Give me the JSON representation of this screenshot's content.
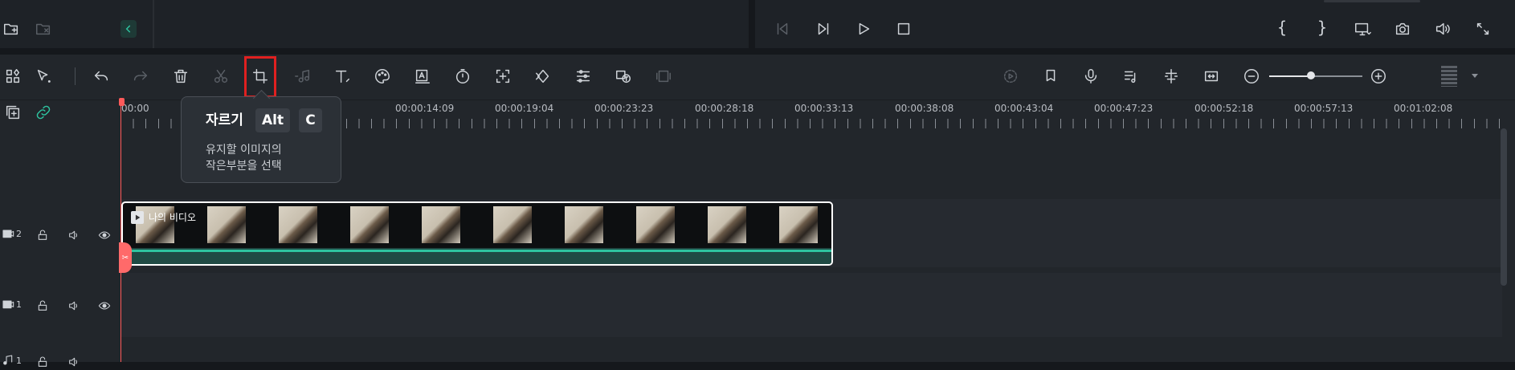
{
  "toolbar": {
    "tooltip": {
      "title": "자르기",
      "keys": [
        "Alt",
        "C"
      ],
      "description_line1": "유지할 이미지의",
      "description_line2": "작은부분을 선택"
    }
  },
  "timeline": {
    "ruler_labels": [
      "00:00",
      "00:00:14:09",
      "00:00:19:04",
      "00:00:23:23",
      "00:00:28:18",
      "00:00:33:13",
      "00:00:38:08",
      "00:00:43:04",
      "00:00:47:23",
      "00:00:52:18",
      "00:00:57:13",
      "00:01:02:08"
    ],
    "tracks": [
      {
        "number": "2"
      },
      {
        "number": "1"
      },
      {
        "number": "1"
      }
    ],
    "clip": {
      "label": "나의 비디오"
    }
  },
  "colors": {
    "accent": "#2ec4a0",
    "playhead": "#ff5a5a",
    "highlight": "#e02020",
    "clip_border": "#ffffff"
  }
}
